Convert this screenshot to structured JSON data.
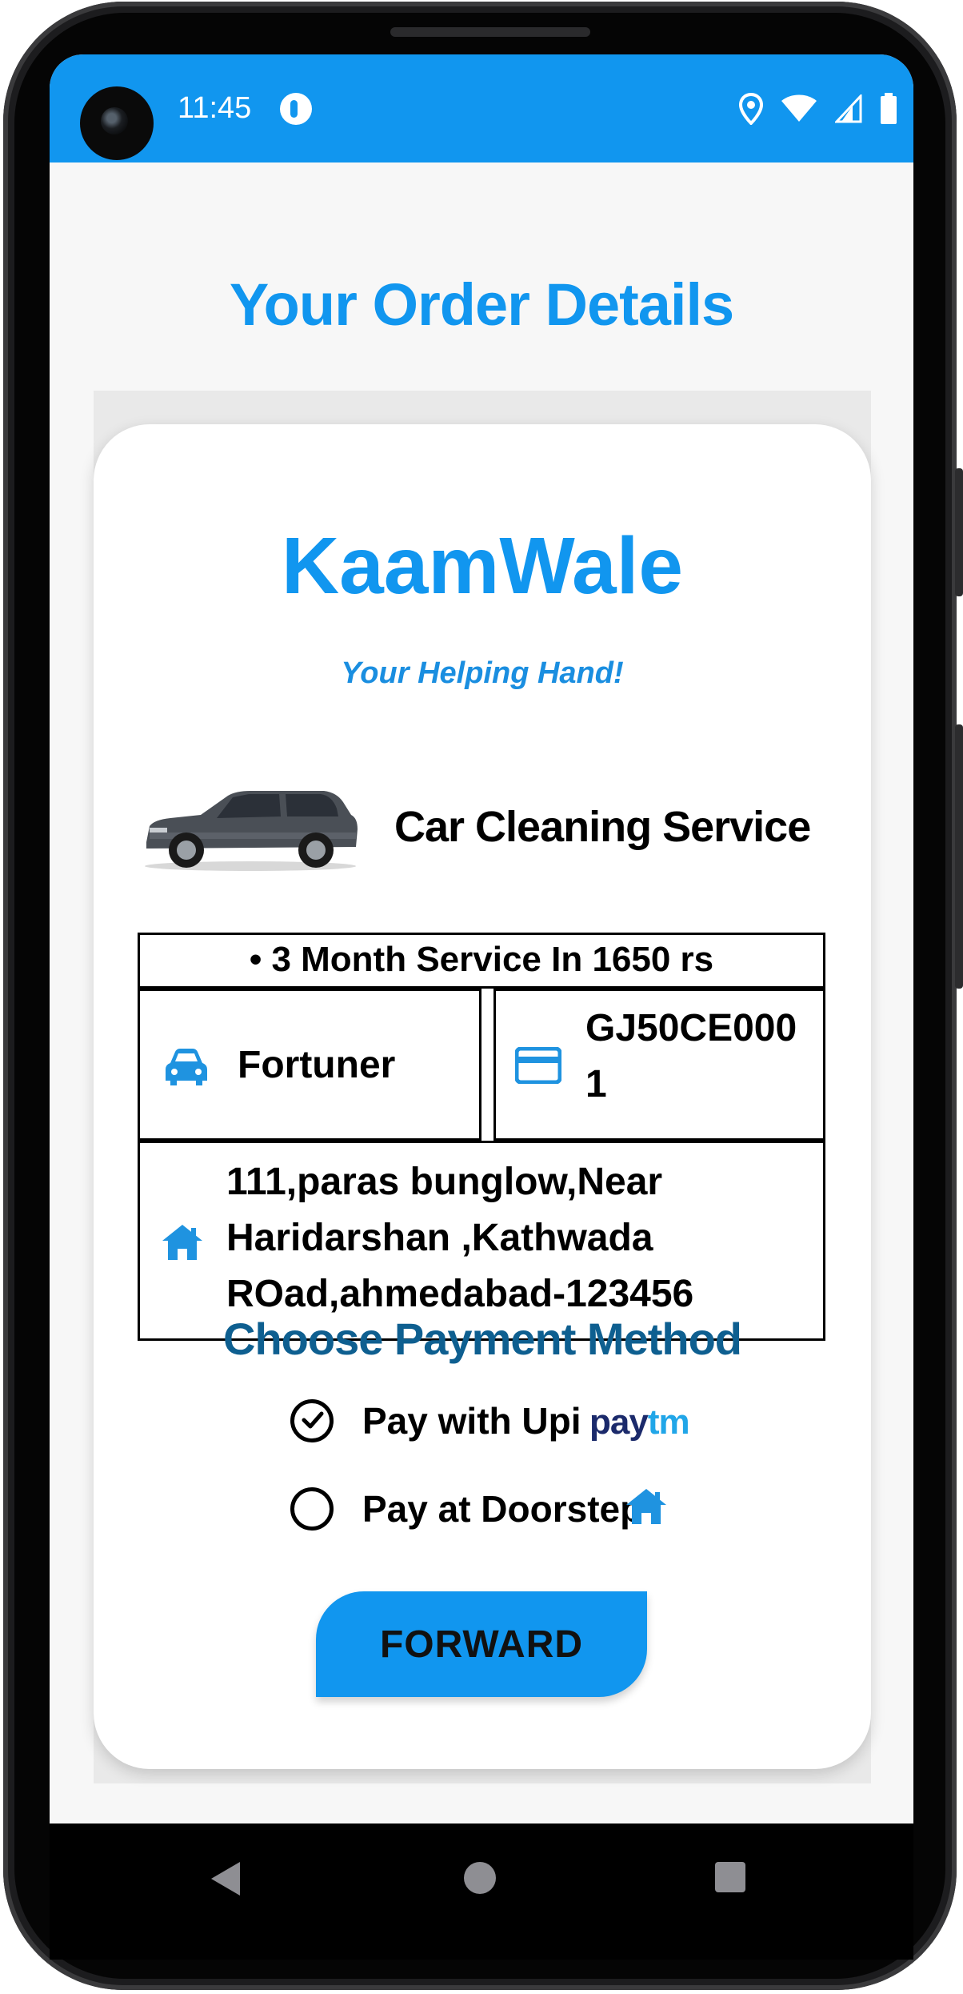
{
  "status_bar": {
    "time": "11:45"
  },
  "page": {
    "title": "Your Order Details"
  },
  "brand": {
    "name": "KaamWale",
    "tagline": "Your Helping Hand!"
  },
  "service": {
    "name": "Car Cleaning Service"
  },
  "order": {
    "plan": "• 3 Month Service In 1650 rs",
    "vehicle_model": "Fortuner",
    "plate_line1": "GJ50CE000",
    "plate_line2": "1",
    "address_line1": "111,paras bunglow,Near",
    "address_line2": "Haridarshan ,Kathwada",
    "address_line3": "ROad,ahmedabad-123456"
  },
  "payment": {
    "title": "Choose Payment Method",
    "options": [
      {
        "label": "Pay with Upi",
        "selected": true,
        "logo_pay": "pay",
        "logo_tm": "tm"
      },
      {
        "label": "Pay at Doorstep",
        "selected": false
      }
    ]
  },
  "actions": {
    "forward_label": "FORWARD"
  },
  "colors": {
    "primary": "#1196ef",
    "payment_title": "#0e5f90"
  }
}
